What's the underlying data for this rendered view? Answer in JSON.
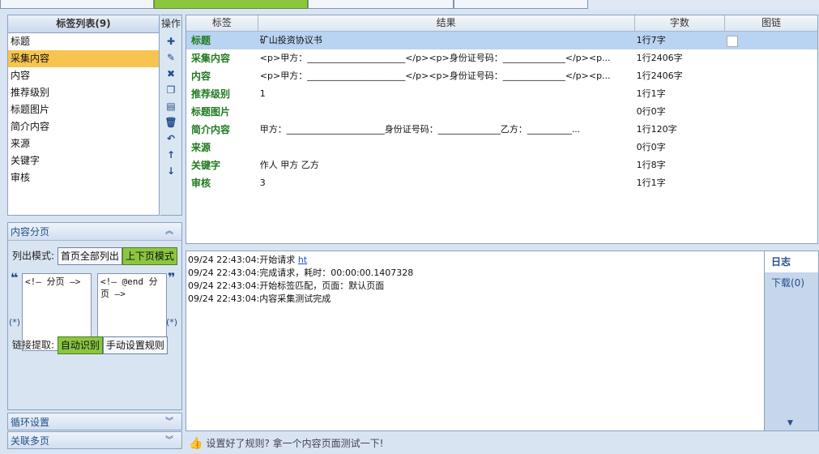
{
  "tag_list": {
    "title": "标签列表(9)",
    "items": [
      "标题",
      "采集内容",
      "内容",
      "推荐级别",
      "标题图片",
      "简介内容",
      "来源",
      "关键字",
      "审核"
    ],
    "selected_index": 1
  },
  "ops": {
    "title": "操作"
  },
  "table": {
    "headers": [
      "标签",
      "结果",
      "字数",
      "图链"
    ],
    "rows": [
      {
        "label": "标题",
        "result": "矿山投资协议书",
        "count": "1行7字"
      },
      {
        "label": "采集内容",
        "result": "<p>甲方：______________________</p><p>身份证号码：______________</p><p...",
        "count": "1行2406字"
      },
      {
        "label": "内容",
        "result": "<p>甲方：______________________</p><p>身份证号码：______________</p><p...",
        "count": "1行2406字"
      },
      {
        "label": "推荐级别",
        "result": "1",
        "count": "1行1字"
      },
      {
        "label": "标题图片",
        "result": "",
        "count": "0行0字"
      },
      {
        "label": "简介内容",
        "result": "甲方：______________________身份证号码：______________乙方：__________...",
        "count": "1行120字"
      },
      {
        "label": "来源",
        "result": "",
        "count": "0行0字"
      },
      {
        "label": "关键字",
        "result": "作人 甲方 乙方",
        "count": "1行8字"
      },
      {
        "label": "审核",
        "result": "3",
        "count": "1行1字"
      }
    ]
  },
  "pagination": {
    "title": "内容分页",
    "mode_label": "列出模式:",
    "mode_btn_1": "首页全部列出",
    "mode_btn_2": "上下页模式",
    "start_marker": "<!— 分页 —>",
    "end_marker": "<!— @end 分页 —>",
    "star": "(*)",
    "link_label": "链接提取:",
    "link_btn_1": "自动识别",
    "link_btn_2": "手动设置规则"
  },
  "sections": {
    "loop": "循环设置",
    "multi": "关联多页"
  },
  "log": {
    "lines": [
      {
        "text": "09/24 22:43:04:开始请求 ",
        "url": "ht"
      },
      {
        "text": "09/24 22:43:04:完成请求，耗时：00:00:00.1407328"
      },
      {
        "text": "09/24 22:43:04:开始标签匹配，页面：默认页面"
      },
      {
        "text": "09/24 22:43:04:内容采集测试完成"
      }
    ]
  },
  "side": {
    "tab": "日志",
    "download": "下载(0)"
  },
  "hint": "设置好了规则? 拿一个内容页面测试一下!"
}
